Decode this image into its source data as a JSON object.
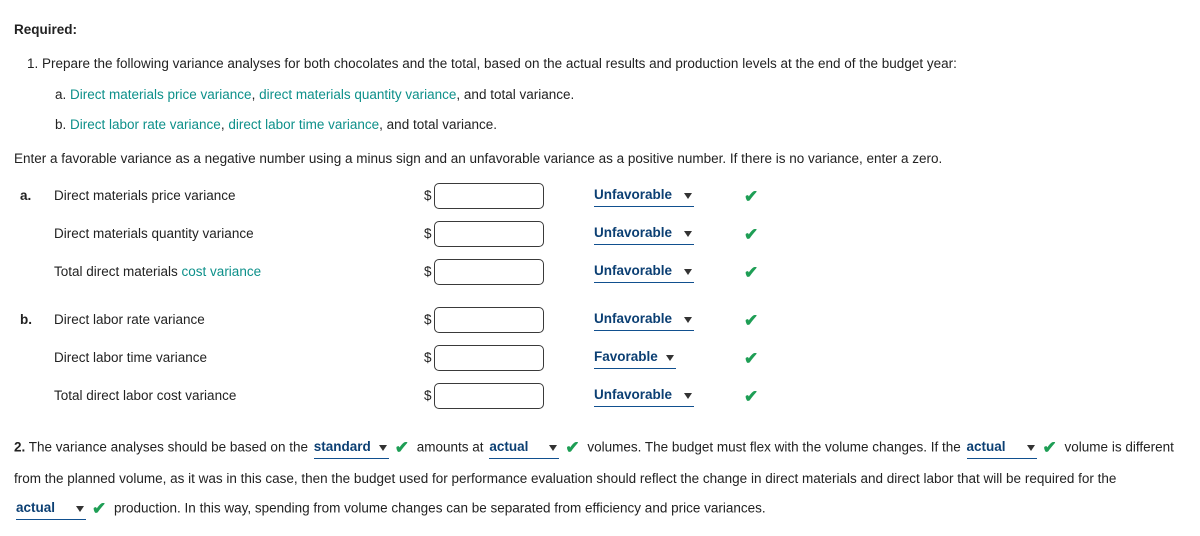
{
  "heading": "Required:",
  "q1_intro": "Prepare the following variance analyses for both chocolates and the total, based on the actual results and production levels at the end of the budget year:",
  "q1a": {
    "link1": "Direct materials price variance",
    "sep1": ", ",
    "link2": "direct materials quantity variance",
    "tail": ", and total variance."
  },
  "q1b": {
    "link1": "Direct labor rate variance",
    "sep1": ", ",
    "link2": "direct labor time variance",
    "tail": ", and total variance."
  },
  "instruction": "Enter a favorable variance as a negative number using a minus sign and an unfavorable variance as a positive number. If there is no variance, enter a zero.",
  "currency": "$",
  "sectionA": {
    "letter": "a.",
    "rows": [
      {
        "label": "Direct materials price variance",
        "dd": "Unfavorable"
      },
      {
        "label": "Direct materials quantity variance",
        "dd": "Unfavorable"
      },
      {
        "label_pre": "Total direct materials ",
        "label_link": "cost variance",
        "dd": "Unfavorable"
      }
    ]
  },
  "sectionB": {
    "letter": "b.",
    "rows": [
      {
        "label": "Direct labor rate variance",
        "dd": "Unfavorable"
      },
      {
        "label": "Direct labor time variance",
        "dd": "Favorable"
      },
      {
        "label": "Total direct labor cost variance",
        "dd": "Unfavorable"
      }
    ]
  },
  "q2": {
    "t1": "The variance analyses should be based on the ",
    "dd1": "standard",
    "t2": " amounts at ",
    "dd2": "actual",
    "t3": " volumes. The budget must flex with the volume changes. If the ",
    "dd3": "actual",
    "t4": " volume is different from the planned volume, as it was in this case, then the budget used for performance evaluation should reflect the change in direct materials and direct labor that will be required for the ",
    "dd4": "actual",
    "t5": " production. In this way, spending from volume changes can be separated from efficiency and price variances."
  },
  "q2_label": "2."
}
